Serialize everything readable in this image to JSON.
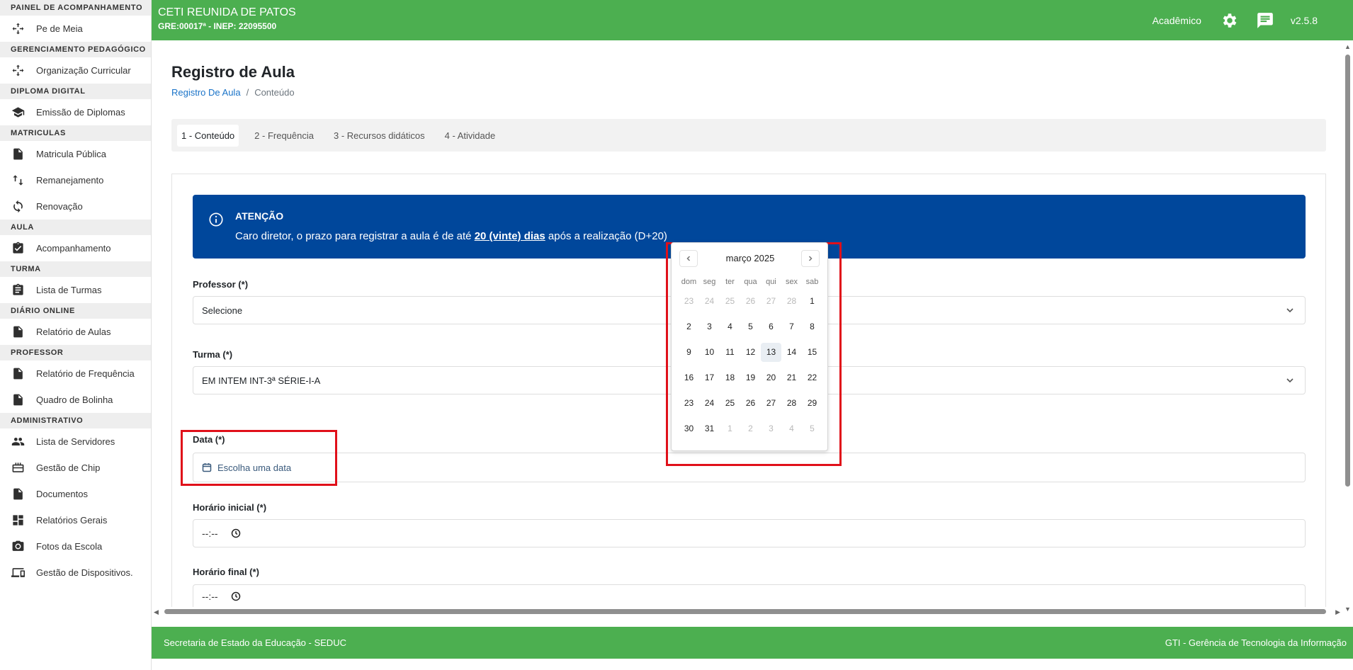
{
  "sidebar": {
    "sections": [
      {
        "title": "PAINEL DE ACOMPANHAMENTO",
        "items": [
          {
            "label": "Pe de Meia",
            "icon": "move-icon"
          }
        ]
      },
      {
        "title": "GERENCIAMENTO PEDAGÓGICO",
        "items": [
          {
            "label": "Organização Curricular",
            "icon": "move-icon"
          }
        ]
      },
      {
        "title": "DIPLOMA DIGITAL",
        "items": [
          {
            "label": "Emissão de Diplomas",
            "icon": "graduation-cap-icon"
          }
        ]
      },
      {
        "title": "MATRICULAS",
        "items": [
          {
            "label": "Matricula Pública",
            "icon": "document-icon"
          },
          {
            "label": "Remanejamento",
            "icon": "swap-vertical-icon"
          },
          {
            "label": "Renovação",
            "icon": "refresh-icon"
          }
        ]
      },
      {
        "title": "AULA",
        "items": [
          {
            "label": "Acompanhamento",
            "icon": "clipboard-check-icon"
          }
        ]
      },
      {
        "title": "TURMA",
        "items": [
          {
            "label": "Lista de Turmas",
            "icon": "clipboard-list-icon"
          }
        ]
      },
      {
        "title": "DIÁRIO ONLINE",
        "items": [
          {
            "label": "Relatório de Aulas",
            "icon": "document-icon"
          }
        ]
      },
      {
        "title": "PROFESSOR",
        "items": [
          {
            "label": "Relatório de Frequência",
            "icon": "document-icon"
          },
          {
            "label": "Quadro de Bolinha",
            "icon": "document-icon"
          }
        ]
      },
      {
        "title": "ADMINISTRATIVO",
        "items": [
          {
            "label": "Lista de Servidores",
            "icon": "people-icon"
          },
          {
            "label": "Gestão de Chip",
            "icon": "sim-card-icon"
          },
          {
            "label": "Documentos",
            "icon": "document-icon"
          },
          {
            "label": "Relatórios Gerais",
            "icon": "dashboard-icon"
          },
          {
            "label": "Fotos da Escola",
            "icon": "camera-icon"
          },
          {
            "label": "Gestão de Dispositivos.",
            "icon": "devices-icon"
          }
        ]
      }
    ]
  },
  "header": {
    "school": "CETI REUNIDA DE PATOS",
    "gre": "GRE:00017ª - INEP: 22095500",
    "module": "Acadêmico",
    "version": "v2.5.8"
  },
  "page": {
    "title": "Registro de Aula",
    "breadcrumb": {
      "link": "Registro De Aula",
      "sep": "/",
      "current": "Conteúdo"
    },
    "tabs": [
      "1 - Conteúdo",
      "2 - Frequência",
      "3 - Recursos didáticos",
      "4 - Atividade"
    ],
    "active_tab": 0
  },
  "alert": {
    "title": "ATENÇÃO",
    "message_pre": "Caro diretor, o prazo para registrar a aula é de até ",
    "message_bold": "20 (vinte) dias",
    "message_post": " após a realização (D+20)"
  },
  "form": {
    "professor": {
      "label": "Professor (*)",
      "value": "Selecione"
    },
    "turma": {
      "label": "Turma (*)",
      "value": "EM INTEM INT-3ª SÉRIE-I-A"
    },
    "data": {
      "label": "Data (*)",
      "placeholder": "Escolha uma data"
    },
    "horario_inicial": {
      "label": "Horário inicial (*)",
      "value": "--:--"
    },
    "horario_final": {
      "label": "Horário final (*)",
      "value": "--:--"
    }
  },
  "calendar": {
    "month": "março 2025",
    "weekdays": [
      "dom",
      "seg",
      "ter",
      "qua",
      "qui",
      "sex",
      "sab"
    ],
    "today": "13",
    "weeks": [
      [
        {
          "d": "23",
          "m": true
        },
        {
          "d": "24",
          "m": true
        },
        {
          "d": "25",
          "m": true
        },
        {
          "d": "26",
          "m": true
        },
        {
          "d": "27",
          "m": true
        },
        {
          "d": "28",
          "m": true
        },
        {
          "d": "1",
          "m": false
        }
      ],
      [
        {
          "d": "2",
          "m": false
        },
        {
          "d": "3",
          "m": false
        },
        {
          "d": "4",
          "m": false
        },
        {
          "d": "5",
          "m": false
        },
        {
          "d": "6",
          "m": false
        },
        {
          "d": "7",
          "m": false
        },
        {
          "d": "8",
          "m": false
        }
      ],
      [
        {
          "d": "9",
          "m": false
        },
        {
          "d": "10",
          "m": false
        },
        {
          "d": "11",
          "m": false
        },
        {
          "d": "12",
          "m": false
        },
        {
          "d": "13",
          "m": false
        },
        {
          "d": "14",
          "m": false
        },
        {
          "d": "15",
          "m": false
        }
      ],
      [
        {
          "d": "16",
          "m": false
        },
        {
          "d": "17",
          "m": false
        },
        {
          "d": "18",
          "m": false
        },
        {
          "d": "19",
          "m": false
        },
        {
          "d": "20",
          "m": false
        },
        {
          "d": "21",
          "m": false
        },
        {
          "d": "22",
          "m": false
        }
      ],
      [
        {
          "d": "23",
          "m": false
        },
        {
          "d": "24",
          "m": false
        },
        {
          "d": "25",
          "m": false
        },
        {
          "d": "26",
          "m": false
        },
        {
          "d": "27",
          "m": false
        },
        {
          "d": "28",
          "m": false
        },
        {
          "d": "29",
          "m": false
        }
      ],
      [
        {
          "d": "30",
          "m": false
        },
        {
          "d": "31",
          "m": false
        },
        {
          "d": "1",
          "m": true
        },
        {
          "d": "2",
          "m": true
        },
        {
          "d": "3",
          "m": true
        },
        {
          "d": "4",
          "m": true
        },
        {
          "d": "5",
          "m": true
        }
      ]
    ]
  },
  "footer": {
    "left": "Secretaria de Estado da Educação - SEDUC",
    "right": "GTI - Gerência de Tecnologia da Informação"
  },
  "colors": {
    "header_green": "#4caf50",
    "alert_blue": "#00479b",
    "highlight_red": "#e0101a",
    "link_blue": "#1a73c8"
  }
}
